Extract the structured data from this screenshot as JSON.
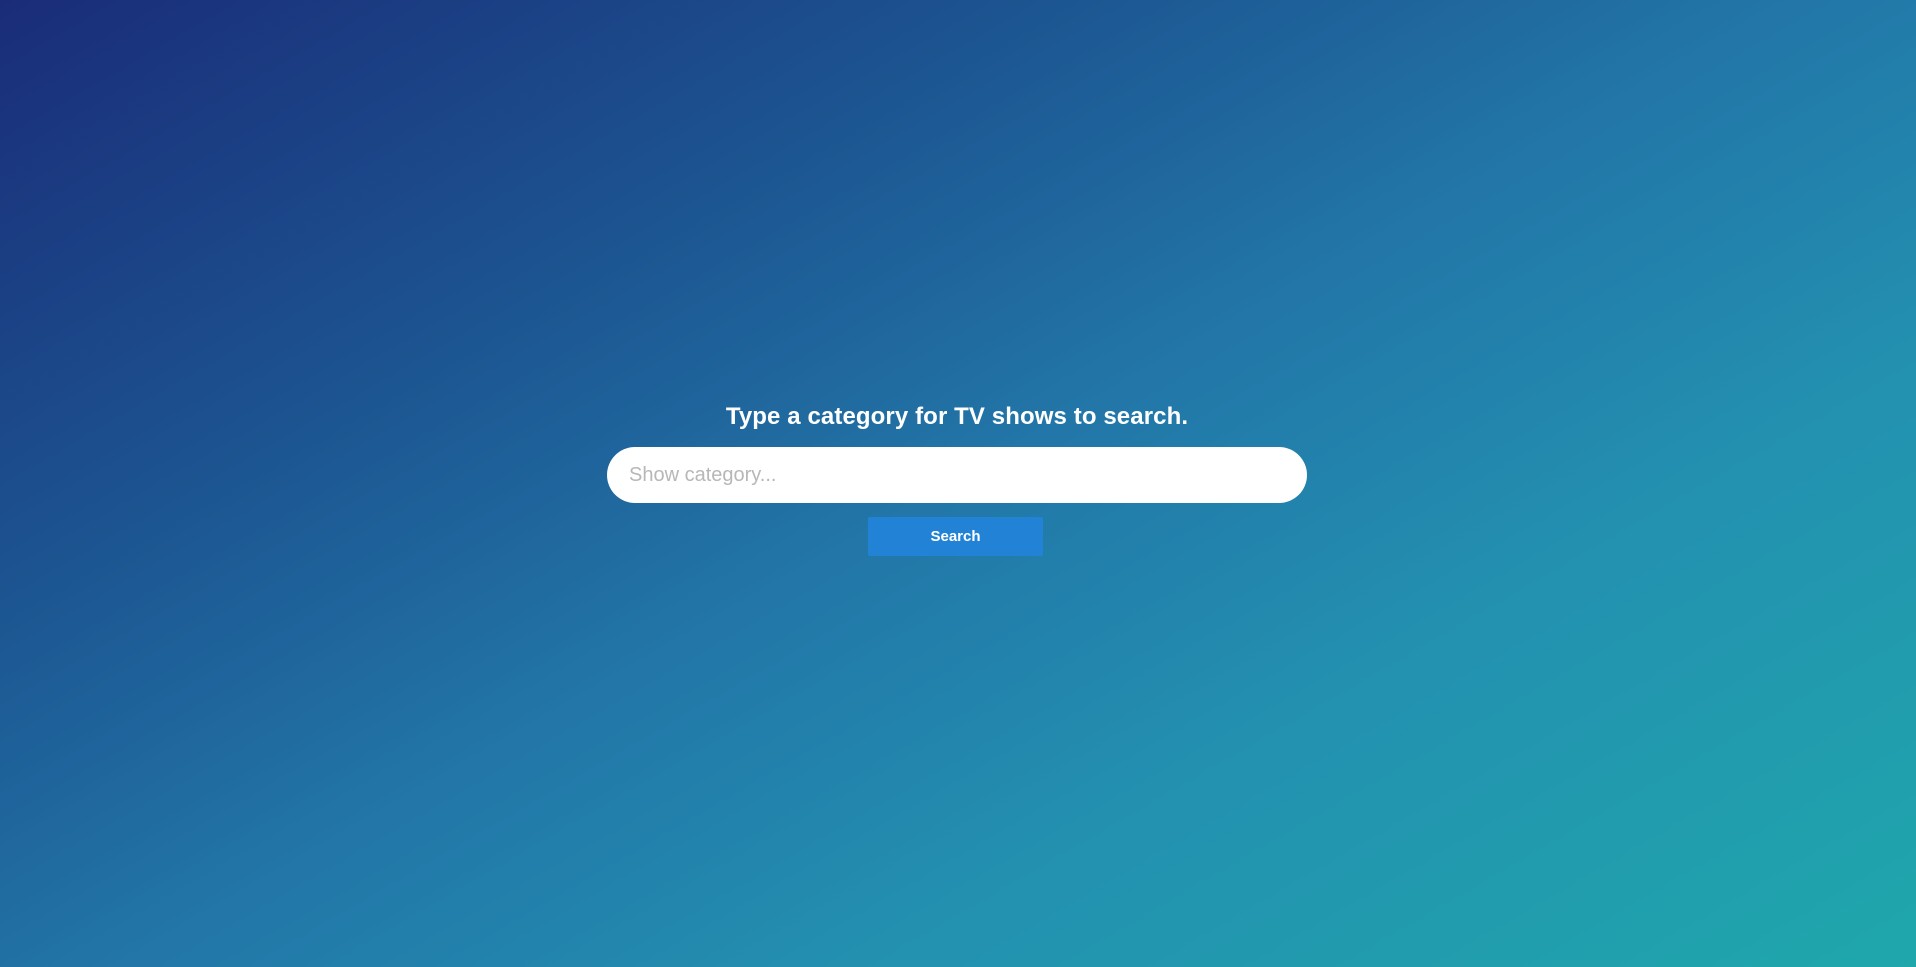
{
  "search": {
    "title": "Type a category for TV shows to search.",
    "placeholder": "Show category...",
    "value": "",
    "button_label": "Search"
  },
  "colors": {
    "background_start": "#1a2c78",
    "background_end": "#1fa7ac",
    "button": "#2283d6",
    "input_background": "#ffffff",
    "text": "#ffffff"
  }
}
